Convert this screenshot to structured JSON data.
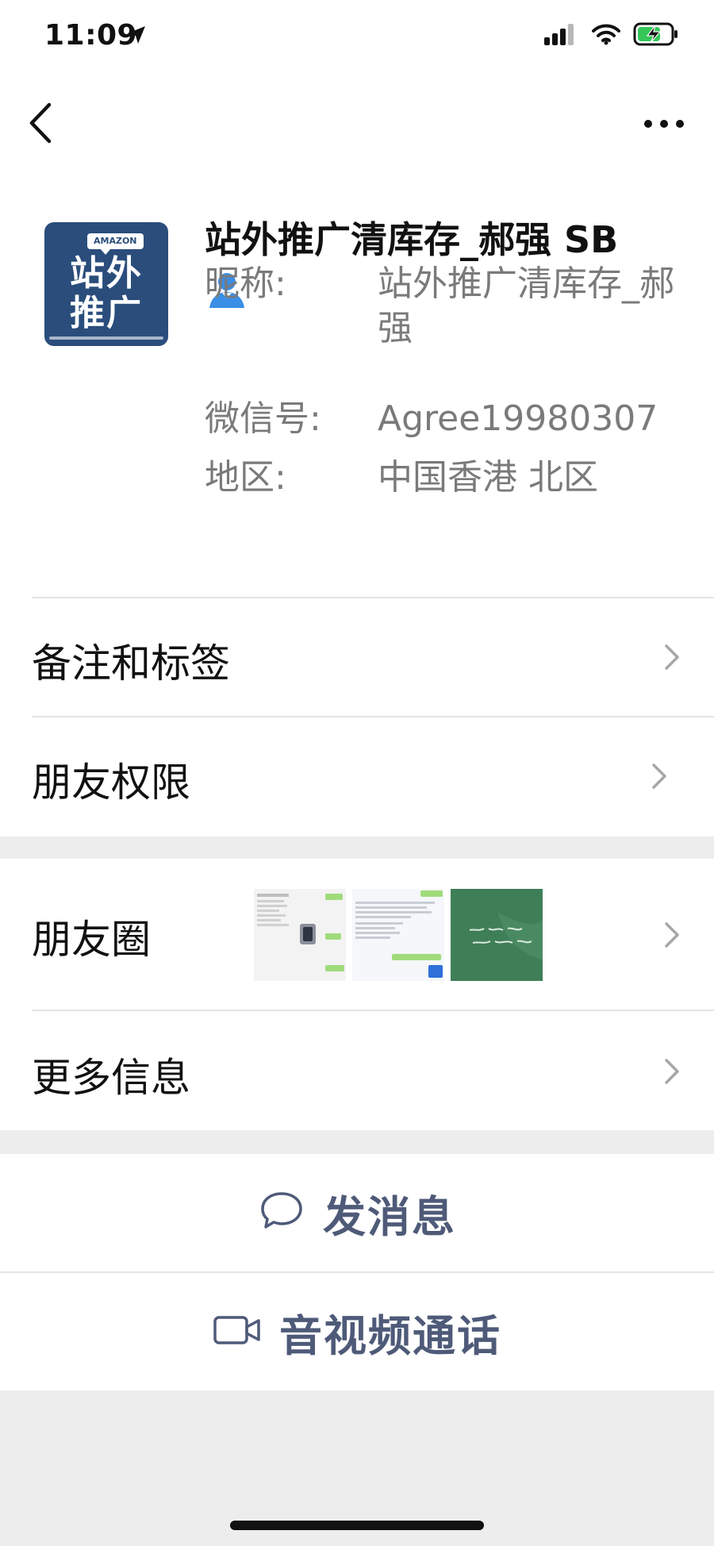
{
  "status_bar": {
    "time": "11:09",
    "location_icon": "location-arrow-icon",
    "signal_icon": "cellular-signal-icon",
    "wifi_icon": "wifi-icon",
    "battery_icon": "battery-charging-icon"
  },
  "nav": {
    "back_icon": "chevron-left-icon",
    "more_icon": "more-dots-icon"
  },
  "profile": {
    "avatar": {
      "brand_tag": "AMAZON",
      "line1": "站外",
      "line2": "推广"
    },
    "name": "站外推广清库存_郝强 SB",
    "badge_icon": "user-badge-icon",
    "fields": [
      {
        "label": "昵称:",
        "value": "站外推广清库存_郝强"
      },
      {
        "label": "微信号:",
        "value": "Agree19980307"
      },
      {
        "label": "地区:",
        "value": "中国香港 北区"
      }
    ]
  },
  "menu": {
    "remark_tags": "备注和标签",
    "friend_permissions": "朋友权限",
    "moments": "朋友圈",
    "more_info": "更多信息"
  },
  "actions": {
    "send_message": "发消息",
    "av_call": "音视频通话"
  },
  "colors": {
    "background": "#ededed",
    "card": "#ffffff",
    "accent_text": "#4e5a78",
    "muted_text": "#7a7a7a",
    "badge_blue": "#3a8ee6"
  }
}
